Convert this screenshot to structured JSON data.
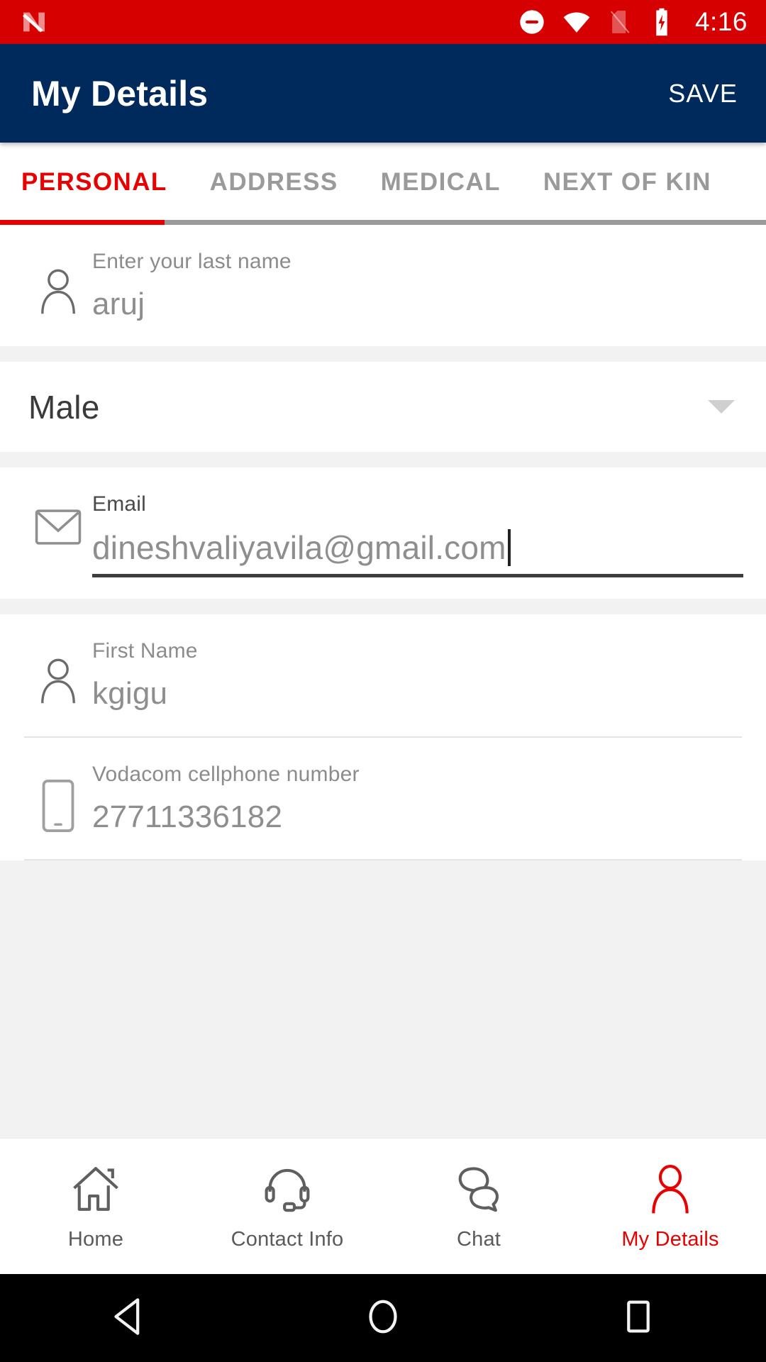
{
  "status_bar": {
    "notification_icon": "android-nougat-icon",
    "icons": [
      "do-not-disturb-icon",
      "wifi-icon",
      "no-sim-card-icon",
      "battery-charging-icon"
    ],
    "time": "4:16"
  },
  "app_bar": {
    "title": "My Details",
    "save_label": "SAVE",
    "background": "#002a5c"
  },
  "tabs": {
    "active_index": 0,
    "items": [
      {
        "label": "PERSONAL"
      },
      {
        "label": "ADDRESS"
      },
      {
        "label": "MEDICAL"
      },
      {
        "label": "NEXT OF KIN"
      }
    ],
    "active_color": "#e60000",
    "inactive_color": "#9a9a9a"
  },
  "form": {
    "last_name": {
      "icon": "person-icon",
      "label": "Enter your last name",
      "value": "aruj"
    },
    "gender": {
      "icon": "chevron-down-icon",
      "value": "Male"
    },
    "email": {
      "icon": "envelope-icon",
      "label": "Email",
      "value": "dineshvaliyavila@gmail.com",
      "focused": true
    },
    "first_name": {
      "icon": "person-icon",
      "label": "First Name",
      "value": "kgigu"
    },
    "cellphone": {
      "icon": "mobile-phone-icon",
      "label": "Vodacom cellphone number",
      "value": "27711336182"
    }
  },
  "bottom_nav": {
    "active_index": 3,
    "items": [
      {
        "label": "Home",
        "icon": "home-icon"
      },
      {
        "label": "Contact Info",
        "icon": "headset-icon"
      },
      {
        "label": "Chat",
        "icon": "chat-bubbles-icon"
      },
      {
        "label": "My Details",
        "icon": "person-icon"
      }
    ],
    "active_color": "#e60000",
    "inactive_color": "#5a5a5a"
  },
  "android_nav": {
    "items": [
      "back-icon",
      "home-icon",
      "recents-icon"
    ]
  }
}
